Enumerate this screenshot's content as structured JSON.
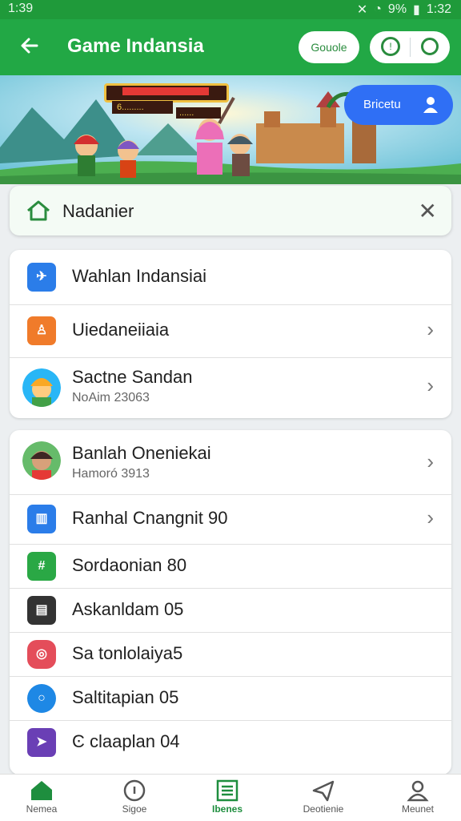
{
  "status_bar": {
    "time": "1:39",
    "battery_text": "9%",
    "clock_right": "1:32"
  },
  "app_bar": {
    "title": "Game Indansia",
    "pill_label": "Gouole"
  },
  "banner": {
    "bubble_label": "Bricetu",
    "hud_text": "6.........",
    "hud_value": "......"
  },
  "search": {
    "text": "Nadanier"
  },
  "list1": [
    {
      "label": "Wahlan Indansiai",
      "icon": "plane-icon",
      "color": "#2b7de9"
    },
    {
      "label": "Uiedaneiiaia",
      "icon": "person-icon",
      "color": "#f07b2a"
    },
    {
      "label": "Sactne Sandan",
      "sub": "NoAim 23063",
      "icon": "avatar"
    }
  ],
  "list2": [
    {
      "label": "Banlah Oneniekai",
      "sub": "Hamoró 3913",
      "icon": "avatar"
    },
    {
      "label": "Ranhal Cnangnit 90",
      "icon": "chart-icon",
      "color": "#2b7de9"
    },
    {
      "label": "Sordaonian 80",
      "icon": "grid-icon",
      "color": "#2aa845"
    },
    {
      "label": "Askanldam 05",
      "icon": "tile-icon",
      "color": "#333333"
    },
    {
      "label": "Sa tonlolaiya5",
      "icon": "camera-icon",
      "color": "#e44d5a"
    },
    {
      "label": "Saltitapian 05",
      "icon": "ring-icon",
      "color": "#1e88e5"
    },
    {
      "label": "Ͼ claaplan 04",
      "icon": "send-icon",
      "color": "#6a3fb5"
    }
  ],
  "tabs": [
    {
      "label": "Nemea",
      "active": false
    },
    {
      "label": "Sigoe",
      "active": false
    },
    {
      "label": "Ibenes",
      "active": true
    },
    {
      "label": "Deotienie",
      "active": false
    },
    {
      "label": "Meunet",
      "active": false
    }
  ],
  "colors": {
    "primary": "#22a845",
    "accent": "#2f6ff5"
  }
}
